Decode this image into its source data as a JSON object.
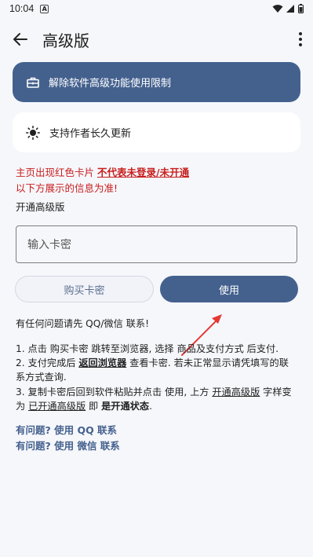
{
  "status_bar": {
    "time": "10:04",
    "badge": "A"
  },
  "app_bar": {
    "title": "高级版"
  },
  "cards": {
    "primary_label": "解除软件高级功能使用限制",
    "secondary_label": "支持作者长久更新"
  },
  "warning": {
    "line1_prefix": "主页出现红色卡片",
    "line1_emphasis": "不代表未登录/未开通",
    "line2": "以下方展示的信息为准!"
  },
  "section_title": "开通高级版",
  "key_input": {
    "placeholder": "输入卡密"
  },
  "buttons": {
    "buy_label": "购买卡密",
    "use_label": "使用"
  },
  "help": {
    "intro": "有任何问题请先 QQ/微信 联系!",
    "step1": "1. 点击 购买卡密 跳转至浏览器, 选择 商品及支付方式 后支付.",
    "step2_a": "2. 支付完成后 ",
    "step2_link": "返回浏览器",
    "step2_b": " 查看卡密. 若未正常显示请凭填写的联",
    "step2_c": "系方式查询.",
    "step3_a": "3. 复制卡密后回到软件粘贴并点击 使用, 上方 ",
    "step3_u1": "开通高级版",
    "step3_b": " 字样变",
    "step3_c": "为 ",
    "step3_u2": "已开通高级版",
    "step3_d": " 即 ",
    "step3_bold": "是开通状态",
    "step3_e": "."
  },
  "contact_links": {
    "qq": "有问题? 使用 QQ 联系",
    "wechat": "有问题? 使用 微信 联系"
  },
  "colors": {
    "accent": "#44618e",
    "warning": "#c81e1e",
    "background": "#f6f7fb",
    "arrow": "#e53935"
  }
}
